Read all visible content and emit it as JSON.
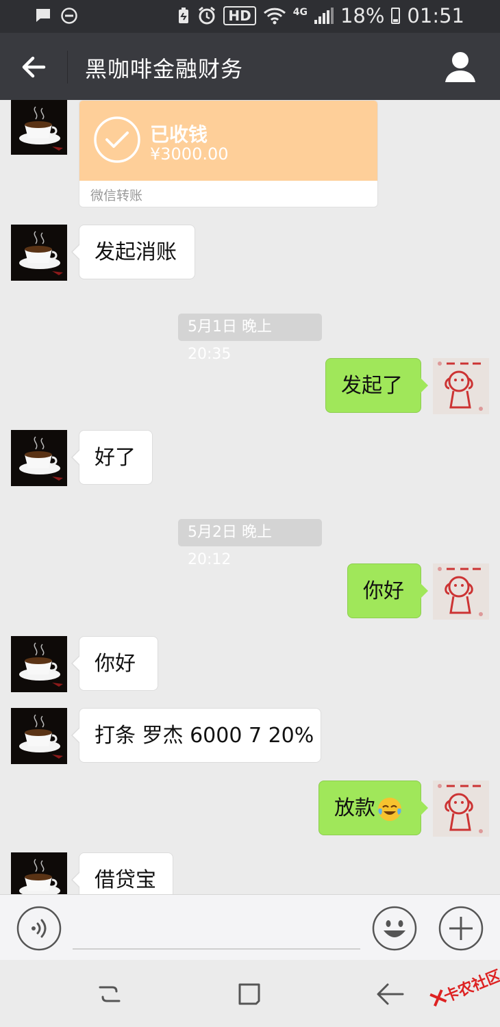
{
  "status_bar": {
    "network": "4G",
    "hd": "HD",
    "battery": "18%",
    "time": "01:51"
  },
  "header": {
    "title": "黑咖啡金融财务"
  },
  "transfer": {
    "status": "已收钱",
    "amount": "¥3000.00",
    "footer": "微信转账",
    "accent_color": "#fecf99"
  },
  "messages": [
    {
      "side": "in",
      "text": "发起消账"
    },
    {
      "timestamp": "5月1日 晚上20:35"
    },
    {
      "side": "out",
      "text": "发起了"
    },
    {
      "side": "in",
      "text": "好了"
    },
    {
      "timestamp": "5月2日 晚上20:12"
    },
    {
      "side": "out",
      "text": "你好"
    },
    {
      "side": "in",
      "text": "你好"
    },
    {
      "side": "in",
      "text": "打条 罗杰 6000 7 20%"
    },
    {
      "side": "out",
      "text": "放款",
      "emoji": "face-with-tears-of-joy"
    },
    {
      "side": "in",
      "text": "借贷宝"
    }
  ],
  "input": {
    "value": "",
    "placeholder": ""
  },
  "watermark": "卡农社区",
  "colors": {
    "outgoing_bubble": "#a0e75a",
    "incoming_bubble": "#ffffff",
    "title_bar": "#393a3f"
  },
  "icons": {
    "back": "arrow-left-icon",
    "contact": "person-icon",
    "voice": "voice-icon",
    "emoji": "smiley-icon",
    "plus": "plus-icon"
  }
}
